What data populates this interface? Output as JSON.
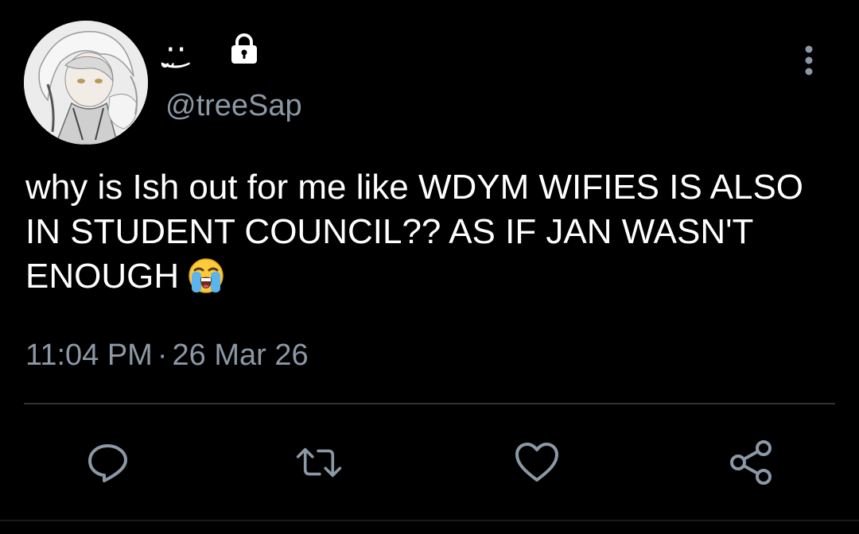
{
  "colors": {
    "background": "#000000",
    "text_primary": "#ffffff",
    "text_secondary": "#8b98a5",
    "divider": "#2f3336"
  },
  "user": {
    "display_name": "·̫͜·",
    "handle": "@treeSap",
    "protected_icon": "lock-icon",
    "avatar_icon": "avatar-image"
  },
  "tweet": {
    "text": "why is Ish out for me like WDYM WIFIES IS ALSO IN STUDENT COUNCIL?? AS IF JAN WASN'T ENOUGH",
    "emoji_icon": "loudly-crying-face-icon",
    "time": "11:04 PM",
    "separator": "·",
    "date": "26 Mar 26"
  },
  "menu": {
    "icon": "more-vertical-icon"
  },
  "actions": [
    {
      "icon": "reply-icon"
    },
    {
      "icon": "retweet-icon"
    },
    {
      "icon": "like-icon"
    },
    {
      "icon": "share-icon"
    }
  ]
}
